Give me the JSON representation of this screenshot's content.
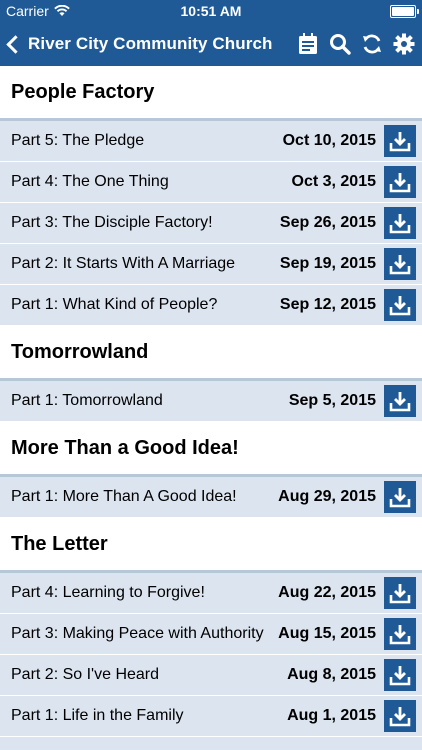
{
  "status": {
    "carrier": "Carrier",
    "time": "10:51 AM"
  },
  "nav": {
    "back_label": "River City Community Church"
  },
  "sections": [
    {
      "title": "People Factory",
      "items": [
        {
          "title": "Part 5: The Pledge",
          "date": "Oct 10, 2015"
        },
        {
          "title": "Part 4: The One Thing",
          "date": "Oct 3, 2015"
        },
        {
          "title": "Part 3: The Disciple Factory!",
          "date": "Sep 26, 2015"
        },
        {
          "title": "Part 2: It Starts With A Marriage",
          "date": "Sep 19, 2015"
        },
        {
          "title": "Part 1: What Kind of People?",
          "date": "Sep 12, 2015"
        }
      ]
    },
    {
      "title": "Tomorrowland",
      "items": [
        {
          "title": "Part 1: Tomorrowland",
          "date": "Sep 5, 2015"
        }
      ]
    },
    {
      "title": "More Than a Good Idea!",
      "items": [
        {
          "title": "Part 1: More Than A Good Idea!",
          "date": "Aug 29, 2015"
        }
      ]
    },
    {
      "title": "The Letter",
      "items": [
        {
          "title": "Part 4: Learning to Forgive!",
          "date": "Aug 22, 2015"
        },
        {
          "title": "Part 3: Making Peace with Authority",
          "date": "Aug 15, 2015"
        },
        {
          "title": "Part 2: So I've Heard",
          "date": "Aug 8, 2015"
        },
        {
          "title": "Part 1: Life in the Family",
          "date": "Aug 1, 2015"
        }
      ]
    }
  ],
  "icons": {
    "nav_actions": [
      "notes-icon",
      "search-icon",
      "refresh-icon",
      "gear-icon"
    ],
    "row_action": "download-icon"
  },
  "colors": {
    "accent": "#1f5a96",
    "row_bg": "#dbe4ef",
    "header_bg": "#ffffff"
  }
}
